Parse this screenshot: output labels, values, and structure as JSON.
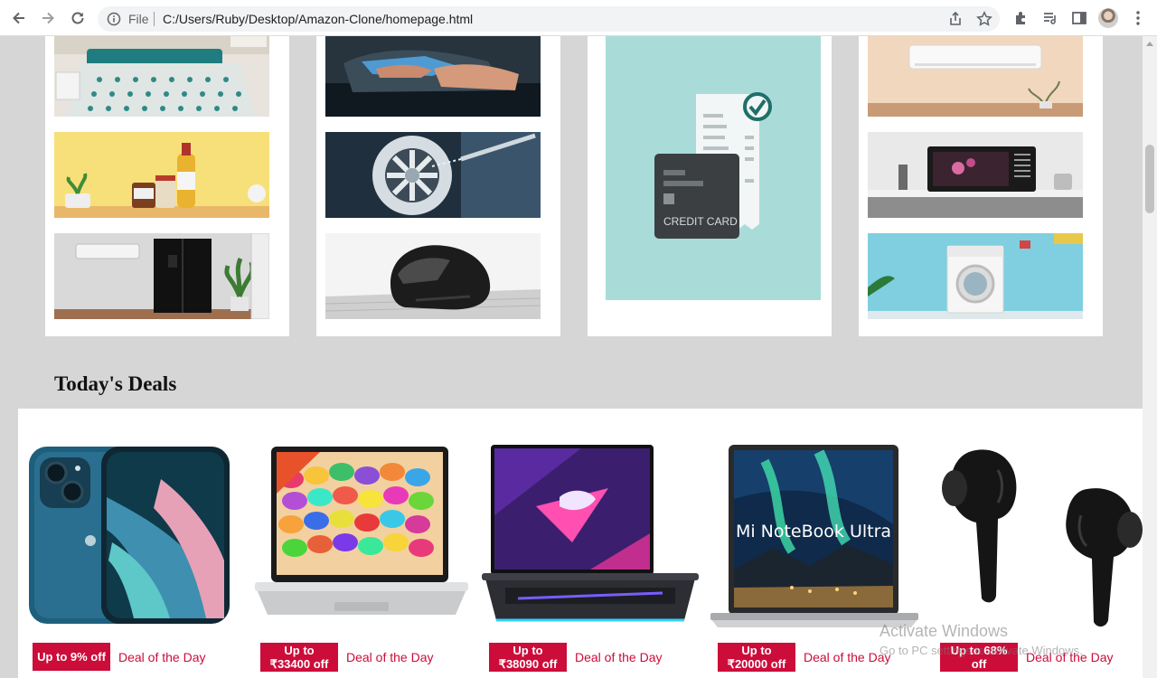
{
  "browser": {
    "scheme": "File",
    "url": "C:/Users/Ruby/Desktop/Amazon-Clone/homepage.html"
  },
  "card_tiles": {
    "credit_card_label": "CREDIT CARD"
  },
  "deals": {
    "heading": "Today's Deals",
    "items": [
      {
        "badge": "Up to 9% off",
        "label": "Deal of the Day",
        "product_icon": "smartphone-icon"
      },
      {
        "badge": "Up to ₹33400 off",
        "label": "Deal of the Day",
        "product_icon": "laptop-icon"
      },
      {
        "badge": "Up to ₹38090 off",
        "label": "Deal of the Day",
        "product_icon": "gaming-laptop-icon"
      },
      {
        "badge": "Up to ₹20000 off",
        "label": "Deal of the Day",
        "product_icon": "notebook-icon",
        "screen_text": "Mi NoteBook Ultra"
      },
      {
        "badge": "Up to 68% off",
        "label": "Deal of the Day",
        "product_icon": "earbuds-icon"
      }
    ]
  },
  "watermark": {
    "line1": "Activate Windows",
    "line2": "Go to PC settings to activate Windows."
  },
  "colors": {
    "page_bg": "#d6d6d6",
    "deal_red": "#cc0c39"
  }
}
